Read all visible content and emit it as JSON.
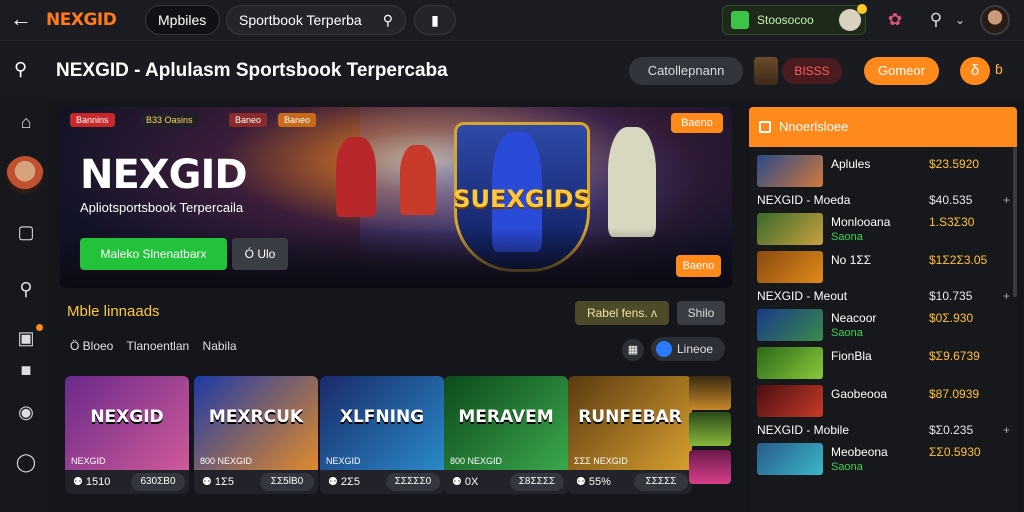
{
  "topbar": {
    "logo": "NEXGID",
    "tab_mpbiles": "Mpbiles",
    "search_value": "Sportbook Terperba",
    "wallet_text": "Stoosocoo"
  },
  "subbar": {
    "title_brand": "NEXGID -",
    "title_rest": " Aplulasm Sportsbook Terpercaba",
    "btn_dark": "Catollepnann",
    "badge": "BISSS",
    "btn_orange": "Gomeor",
    "coin_text": "δ"
  },
  "hero": {
    "chips": [
      "Bannins",
      "B33  Oasins",
      "Baneo",
      "Baneo"
    ],
    "brand": "NEXGID",
    "subtitle": "Apliotsportsbook Terpercaila",
    "cta_primary": "Maleko Slnenatbarx",
    "cta_secondary": "Ó  Ulo",
    "shield_text": "SUEXGIDS",
    "tag_top": "Baeno",
    "tag_bottom": "Baeno"
  },
  "section": {
    "title": "Mble linnaads",
    "filter_primary": "Rabel  fens.  ᴧ",
    "filter_secondary": "Shilo",
    "crumbs": [
      "Ö  Bloeo",
      "Tlanoentlan",
      "Nabila"
    ],
    "pill_blue": "Lineoe"
  },
  "cards": [
    {
      "title": "NEXGID",
      "label": "NEXGID",
      "stat": "1510",
      "meta": "630ΣB0",
      "colors": [
        "#6a2a8a",
        "#d05a9a"
      ]
    },
    {
      "title": "MEXRCUK",
      "label": "800 NEXGID",
      "stat": "1Σ5",
      "meta": "ΣΣ5lB0",
      "colors": [
        "#1d3aa8",
        "#e08a2a"
      ]
    },
    {
      "title": "XLFNING",
      "label": "NEXGID",
      "stat": "2Σ5",
      "meta": "ΣΣΣΣΣ0",
      "colors": [
        "#1a2a6a",
        "#2a8ac8"
      ]
    },
    {
      "title": "MERAVEM",
      "label": "800 NEXGID",
      "stat": "0X",
      "meta": "Σ8ΣΣΣΣ",
      "colors": [
        "#0e4a1e",
        "#3aa84a"
      ]
    },
    {
      "title": "RUNFEBAR",
      "label": "ΣΣΣ  NEXGID",
      "stat": "55%",
      "meta": "ΣΣΣΣΣ",
      "colors": [
        "#5a3a10",
        "#d8a030"
      ]
    }
  ],
  "right_panel": {
    "header": "Nnoerlsloee",
    "entries": [
      {
        "type": "item",
        "name": "Aplules",
        "sub": "",
        "price": "$23.5920",
        "colors": [
          "#2a4a8a",
          "#d07a3a"
        ]
      },
      {
        "type": "row",
        "name": "NEXGID - Moeda",
        "price": "$40.535",
        "plus": "+"
      },
      {
        "type": "item",
        "name": "Monlooana",
        "sub": "Saona",
        "price": "1.S3Σ30",
        "colors": [
          "#3a6a2a",
          "#c8a040"
        ]
      },
      {
        "type": "item",
        "name": "No 1ΣΣ",
        "sub": "",
        "price": "$1Σ2Σ3.05",
        "colors": [
          "#8a4a10",
          "#e08a1a"
        ]
      },
      {
        "type": "row",
        "name": "NEXGID - Meout",
        "price": "$10.735",
        "plus": "+"
      },
      {
        "type": "item",
        "name": "Neacoor",
        "sub": "Saona",
        "price": "$0Σ.930",
        "colors": [
          "#1a3a8a",
          "#3a8a4a"
        ]
      },
      {
        "type": "item",
        "name": "FionBla",
        "sub": "",
        "price": "$Σ9.6739",
        "colors": [
          "#2a6a1a",
          "#8ac83a"
        ]
      },
      {
        "type": "item",
        "name": "Gaobeooa",
        "sub": "",
        "price": "$87.0939",
        "colors": [
          "#4a1010",
          "#c83a2a"
        ]
      },
      {
        "type": "row",
        "name": "NEXGID - Mobile",
        "price": "$Σ0.235",
        "plus": "+"
      },
      {
        "type": "item",
        "name": "Meobeona",
        "sub": "Saona",
        "price": "ΣΣ0.5930",
        "colors": [
          "#2a5a8a",
          "#3ab8c8"
        ]
      }
    ]
  }
}
